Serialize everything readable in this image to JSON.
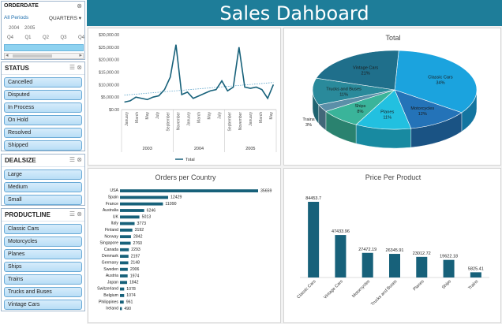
{
  "header": {
    "title": "Sales Dahboard"
  },
  "timeline": {
    "title": "ORDERDATE",
    "filter_selection": "All Periods",
    "level": "QUARTERS",
    "years": [
      "2004",
      "2005"
    ],
    "quarters": [
      "Q4",
      "Q1",
      "Q2",
      "Q3",
      "Q4"
    ],
    "clear_icon": "filter-clear-icon"
  },
  "slicers": {
    "status": {
      "title": "STATUS",
      "items": [
        "Cancelled",
        "Disputed",
        "In Process",
        "On Hold",
        "Resolved",
        "Shipped"
      ]
    },
    "dealsize": {
      "title": "DEALSIZE",
      "items": [
        "Large",
        "Medium",
        "Small"
      ]
    },
    "productline": {
      "title": "PRODUCTLINE",
      "items": [
        "Classic Cars",
        "Motorcycles",
        "Planes",
        "Ships",
        "Trains",
        "Trucks and Buses",
        "Vintage Cars"
      ]
    }
  },
  "colors": {
    "header": "#1e7d99",
    "bar": "#17617a",
    "line": "#17617a",
    "trend": "#5ba3c9"
  },
  "chart_data": [
    {
      "type": "line",
      "title": "",
      "legend": [
        "Total"
      ],
      "y_ticks": [
        "$30,000.00",
        "$25,000.00",
        "$20,000.00",
        "$15,000.00",
        "$10,000.00",
        "$5,000.00",
        "$0.00"
      ],
      "ylim": [
        0,
        30000
      ],
      "x_labels": [
        "January",
        "March",
        "May",
        "July",
        "September",
        "November",
        "January",
        "March",
        "May",
        "July",
        "September",
        "November",
        "January",
        "March",
        "May"
      ],
      "year_labels": [
        "2003",
        "2004",
        "2005"
      ],
      "series": [
        {
          "name": "Total",
          "values": [
            3000,
            3500,
            5000,
            4500,
            4000,
            5000,
            5500,
            8000,
            13000,
            26000,
            6000,
            7000,
            4500,
            5500,
            6500,
            7500,
            8000,
            11500,
            7500,
            9000,
            25000,
            9000,
            8500,
            9000,
            8000,
            4500,
            10000
          ]
        }
      ],
      "trendline": true
    },
    {
      "type": "pie",
      "title": "Total",
      "slices": [
        {
          "label": "Classic Cars",
          "value": 34,
          "text": "34%",
          "color": "#1ba3de"
        },
        {
          "label": "Motorcycles",
          "value": 12,
          "text": "12%",
          "color": "#2473b8"
        },
        {
          "label": "Planes",
          "value": 11,
          "text": "11%",
          "color": "#22c0e0"
        },
        {
          "label": "Ships",
          "value": 8,
          "text": "8%",
          "color": "#3ab49a"
        },
        {
          "label": "Trains",
          "value": 3,
          "text": "3%",
          "color": "#5b8fa8"
        },
        {
          "label": "Trucks and Buses",
          "value": 11,
          "text": "11%",
          "color": "#2a8a9b"
        },
        {
          "label": "Vintage Cars",
          "value": 21,
          "text": "21%",
          "color": "#1f6f8b"
        }
      ]
    },
    {
      "type": "bar",
      "title": "Orders per Country",
      "categories": [
        "USA",
        "Spain",
        "France",
        "Australia",
        "UK",
        "Italy",
        "Finland",
        "Norway",
        "Singapore",
        "Canada",
        "Denmark",
        "Germany",
        "Sweden",
        "Austria",
        "Japan",
        "Switzerland",
        "Belgium",
        "Philippines",
        "Ireland"
      ],
      "values": [
        35659,
        12429,
        11090,
        6246,
        5013,
        3773,
        3192,
        2842,
        2760,
        2293,
        2197,
        2148,
        2006,
        1974,
        1842,
        1078,
        1074,
        961,
        490
      ]
    },
    {
      "type": "bar",
      "title": "Price Per Product",
      "categories": [
        "Classic Cars",
        "Vintage Cars",
        "Motorcycles",
        "Trucks and Buses",
        "Planes",
        "Ships",
        "Trains"
      ],
      "values": [
        84453.7,
        47433.96,
        27472.19,
        26345.91,
        23012.72,
        19622.18,
        5825.41
      ],
      "value_labels": [
        "84453.7",
        "47433.96",
        "27472.19",
        "26345.91",
        "23012.72",
        "19622.18",
        "5825.41"
      ]
    }
  ]
}
